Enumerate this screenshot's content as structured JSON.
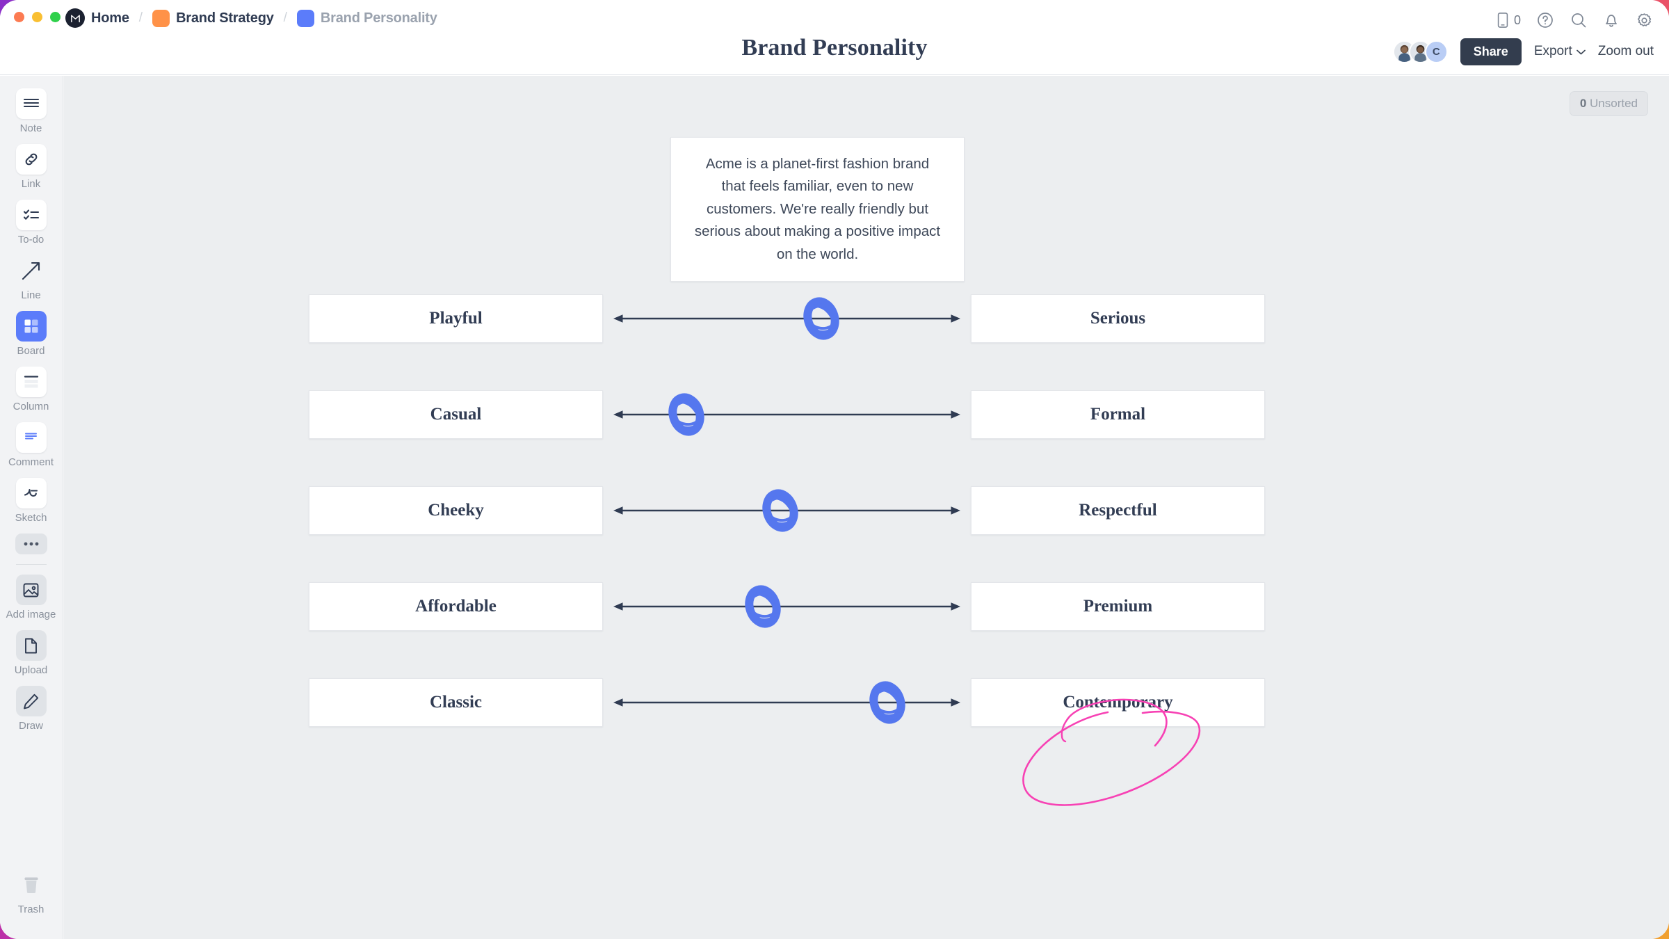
{
  "window": {
    "traffic_lights": [
      "close",
      "minimize",
      "maximize"
    ]
  },
  "header": {
    "breadcrumb": [
      {
        "label": "Home",
        "icon": "milanote-logo-icon",
        "muted": false
      },
      {
        "label": "Brand Strategy",
        "icon": "orange-board-icon",
        "muted": false
      },
      {
        "label": "Brand Personality",
        "icon": "blue-board-icon",
        "muted": true
      }
    ],
    "separator": "/",
    "title": "Brand Personality",
    "icons": [
      {
        "name": "mobile-icon",
        "count": "0"
      },
      {
        "name": "help-icon"
      },
      {
        "name": "search-icon"
      },
      {
        "name": "notifications-icon"
      },
      {
        "name": "settings-icon"
      }
    ],
    "avatars": [
      {
        "name": "avatar-user-1",
        "type": "photo"
      },
      {
        "name": "avatar-user-2",
        "type": "photo"
      },
      {
        "name": "avatar-user-3",
        "type": "initial",
        "initial": "C"
      }
    ],
    "share_label": "Share",
    "export_label": "Export",
    "export_caret": "⌄",
    "zoom_label": "Zoom out"
  },
  "sidebar": {
    "tools": [
      {
        "label": "Note",
        "icon": "note-icon",
        "style": "white"
      },
      {
        "label": "Link",
        "icon": "link-icon",
        "style": "white"
      },
      {
        "label": "To-do",
        "icon": "todo-icon",
        "style": "white"
      },
      {
        "label": "Line",
        "icon": "line-arrow-icon",
        "style": "plain"
      },
      {
        "label": "Board",
        "icon": "board-icon",
        "style": "active"
      },
      {
        "label": "Column",
        "icon": "column-icon",
        "style": "white"
      },
      {
        "label": "Comment",
        "icon": "comment-icon",
        "style": "white"
      },
      {
        "label": "Sketch",
        "icon": "sketch-icon",
        "style": "white"
      },
      {
        "label": "",
        "icon": "more-options-icon",
        "style": "dots"
      }
    ],
    "tools_secondary": [
      {
        "label": "Add image",
        "icon": "image-icon",
        "style": "flat"
      },
      {
        "label": "Upload",
        "icon": "upload-file-icon",
        "style": "flat"
      },
      {
        "label": "Draw",
        "icon": "pencil-icon",
        "style": "flat"
      }
    ],
    "trash": {
      "label": "Trash",
      "icon": "trash-icon"
    }
  },
  "canvas": {
    "unsorted_count": "0",
    "unsorted_label": "Unsorted",
    "description": "Acme is a planet-first fashion brand that feels familiar, even to new customers. We're really friendly but serious about making a positive impact on the world."
  },
  "chart_data": {
    "type": "scatter",
    "title": "Brand Personality",
    "description": "Bipolar semantic-differential sliders. Each row is an axis between two opposing brand traits; the blue marker shows the brand's position along that axis (0 = left pole, 100 = right pole).",
    "xlabel": "",
    "ylabel": "",
    "xlim": [
      0,
      100
    ],
    "grid": false,
    "legend": "none",
    "rows": [
      {
        "left": "Playful",
        "right": "Serious",
        "position": 60,
        "marker": "blue-scribble"
      },
      {
        "left": "Casual",
        "right": "Formal",
        "position": 21,
        "marker": "blue-scribble"
      },
      {
        "left": "Cheeky",
        "right": "Respectful",
        "position": 48,
        "marker": "blue-scribble"
      },
      {
        "left": "Affordable",
        "right": "Premium",
        "position": 43,
        "marker": "blue-scribble"
      },
      {
        "left": "Classic",
        "right": "Contemporary",
        "position": 79,
        "marker": "blue-scribble"
      }
    ],
    "annotations": [
      {
        "type": "hand-drawn-ellipse",
        "color": "#f741b4",
        "target": "Contemporary"
      }
    ]
  },
  "colors": {
    "accent_blue": "#5b7cfa",
    "marker_blue": "#5577ee",
    "annotation_pink": "#f741b4",
    "brand_orange": "#ff9248",
    "text_dark": "#323d54",
    "canvas_bg": "#eceef0",
    "share_btn": "#333d4e"
  }
}
